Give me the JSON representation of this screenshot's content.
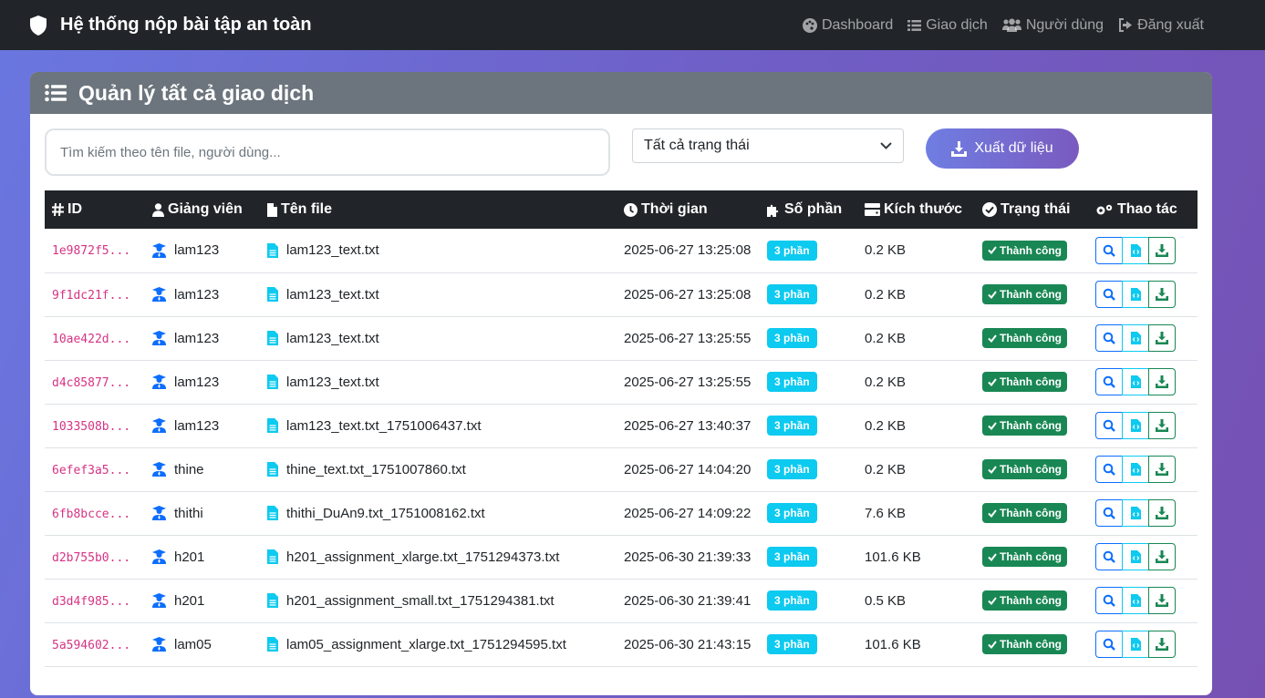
{
  "nav": {
    "brand": "Hệ thống nộp bài tập an toàn",
    "links": [
      {
        "label": "Dashboard",
        "icon": "palette-icon"
      },
      {
        "label": "Giao dịch",
        "icon": "list-icon"
      },
      {
        "label": "Người dùng",
        "icon": "users-icon"
      },
      {
        "label": "Đăng xuất",
        "icon": "logout-icon"
      }
    ]
  },
  "page": {
    "title": "Quản lý tất cả giao dịch",
    "search_placeholder": "Tìm kiếm theo tên file, người dùng...",
    "status_filter": "Tất cả trạng thái",
    "export_label": "Xuất dữ liệu"
  },
  "table": {
    "headers": [
      "ID",
      "Giảng viên",
      "Tên file",
      "Thời gian",
      "Số phần",
      "Kích thước",
      "Trạng thái",
      "Thao tác"
    ],
    "rows": [
      {
        "id": "1e9872f5...",
        "user": "lam123",
        "file": "lam123_text.txt",
        "time": "2025-06-27 13:25:08",
        "parts": "3 phần",
        "size": "0.2 KB",
        "status": "Thành công"
      },
      {
        "id": "9f1dc21f...",
        "user": "lam123",
        "file": "lam123_text.txt",
        "time": "2025-06-27 13:25:08",
        "parts": "3 phần",
        "size": "0.2 KB",
        "status": "Thành công"
      },
      {
        "id": "10ae422d...",
        "user": "lam123",
        "file": "lam123_text.txt",
        "time": "2025-06-27 13:25:55",
        "parts": "3 phần",
        "size": "0.2 KB",
        "status": "Thành công"
      },
      {
        "id": "d4c85877...",
        "user": "lam123",
        "file": "lam123_text.txt",
        "time": "2025-06-27 13:25:55",
        "parts": "3 phần",
        "size": "0.2 KB",
        "status": "Thành công"
      },
      {
        "id": "1033508b...",
        "user": "lam123",
        "file": "lam123_text.txt_1751006437.txt",
        "time": "2025-06-27 13:40:37",
        "parts": "3 phần",
        "size": "0.2 KB",
        "status": "Thành công"
      },
      {
        "id": "6efef3a5...",
        "user": "thine",
        "file": "thine_text.txt_1751007860.txt",
        "time": "2025-06-27 14:04:20",
        "parts": "3 phần",
        "size": "0.2 KB",
        "status": "Thành công"
      },
      {
        "id": "6fb8bcce...",
        "user": "thithi",
        "file": "thithi_DuAn9.txt_1751008162.txt",
        "time": "2025-06-27 14:09:22",
        "parts": "3 phần",
        "size": "7.6 KB",
        "status": "Thành công"
      },
      {
        "id": "d2b755b0...",
        "user": "h201",
        "file": "h201_assignment_xlarge.txt_1751294373.txt",
        "time": "2025-06-30 21:39:33",
        "parts": "3 phần",
        "size": "101.6 KB",
        "status": "Thành công"
      },
      {
        "id": "d3d4f985...",
        "user": "h201",
        "file": "h201_assignment_small.txt_1751294381.txt",
        "time": "2025-06-30 21:39:41",
        "parts": "3 phần",
        "size": "0.5 KB",
        "status": "Thành công"
      },
      {
        "id": "5a594602...",
        "user": "lam05",
        "file": "lam05_assignment_xlarge.txt_1751294595.txt",
        "time": "2025-06-30 21:43:15",
        "parts": "3 phần",
        "size": "101.6 KB",
        "status": "Thành công"
      }
    ]
  },
  "colors": {
    "navbar": "#212529",
    "card_header": "#6c757d",
    "info": "#0dcaf0",
    "success": "#198754",
    "primary": "#0d6efd",
    "id_text": "#d63384"
  }
}
